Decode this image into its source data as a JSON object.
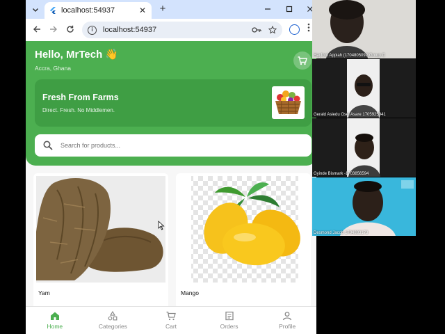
{
  "browser": {
    "tab_title": "localhost:54937",
    "url": "localhost:54937",
    "new_tab_symbol": "+",
    "close_tab_symbol": "✕"
  },
  "app": {
    "greeting": "Hello, MrTech 👋",
    "location": "Accra, Ghana",
    "banner": {
      "title": "Fresh From Farms",
      "subtitle": "Direct. Fresh. No Middlemen."
    },
    "search": {
      "placeholder": "Search for products..."
    },
    "products": [
      {
        "name": "Yam"
      },
      {
        "name": "Mango"
      }
    ],
    "nav": [
      {
        "label": "Home",
        "icon": "home-icon",
        "active": true
      },
      {
        "label": "Categories",
        "icon": "categories-icon",
        "active": false
      },
      {
        "label": "Cart",
        "icon": "cart-icon",
        "active": false
      },
      {
        "label": "Orders",
        "icon": "orders-icon",
        "active": false
      },
      {
        "label": "Profile",
        "icon": "profile-icon",
        "active": false
      }
    ],
    "colors": {
      "primary": "#4caf50",
      "banner": "#3f9e44",
      "muted": "#8a8a8a"
    }
  },
  "video_call": {
    "participants": [
      {
        "name": "Hayford Appiah (1704805092)Group C"
      },
      {
        "name": "Gerald Asiedu Osei Asare 1705925941"
      },
      {
        "name": "Gyinde Bismark -1703856594"
      },
      {
        "name": "Desmond Jacob 1704883173"
      }
    ]
  }
}
